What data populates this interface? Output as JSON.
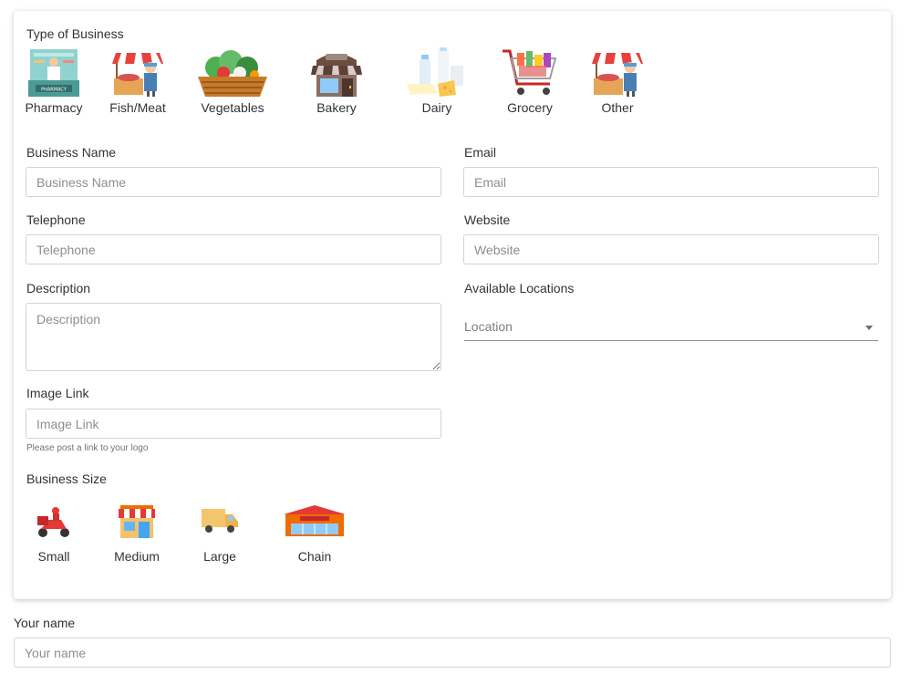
{
  "business_type": {
    "label": "Type of Business",
    "items": [
      {
        "name": "Pharmacy",
        "icon": "pharmacy-icon"
      },
      {
        "name": "Fish/Meat",
        "icon": "fish-meat-stall-icon"
      },
      {
        "name": "Vegetables",
        "icon": "vegetable-basket-icon"
      },
      {
        "name": "Bakery",
        "icon": "bakery-icon"
      },
      {
        "name": "Dairy",
        "icon": "dairy-icon"
      },
      {
        "name": "Grocery",
        "icon": "grocery-cart-icon"
      },
      {
        "name": "Other",
        "icon": "market-stall-icon"
      }
    ]
  },
  "fields": {
    "business_name": {
      "label": "Business Name",
      "placeholder": "Business Name",
      "value": ""
    },
    "email": {
      "label": "Email",
      "placeholder": "Email",
      "value": ""
    },
    "telephone": {
      "label": "Telephone",
      "placeholder": "Telephone",
      "value": ""
    },
    "website": {
      "label": "Website",
      "placeholder": "Website",
      "value": ""
    },
    "description": {
      "label": "Description",
      "placeholder": "Description",
      "value": ""
    },
    "locations": {
      "label": "Available Locations",
      "placeholder": "Location"
    },
    "image_link": {
      "label": "Image Link",
      "placeholder": "Image Link",
      "help": "Please post a link to your logo",
      "value": ""
    }
  },
  "business_size": {
    "label": "Business Size",
    "items": [
      {
        "name": "Small",
        "icon": "delivery-scooter-icon"
      },
      {
        "name": "Medium",
        "icon": "storefront-icon"
      },
      {
        "name": "Large",
        "icon": "delivery-truck-icon"
      },
      {
        "name": "Chain",
        "icon": "supermarket-icon"
      }
    ]
  },
  "your_name": {
    "label": "Your name",
    "placeholder": "Your name",
    "value": ""
  },
  "colors": {
    "input_border": "#ced4da",
    "text": "#333333",
    "placeholder": "#8a8f94"
  }
}
